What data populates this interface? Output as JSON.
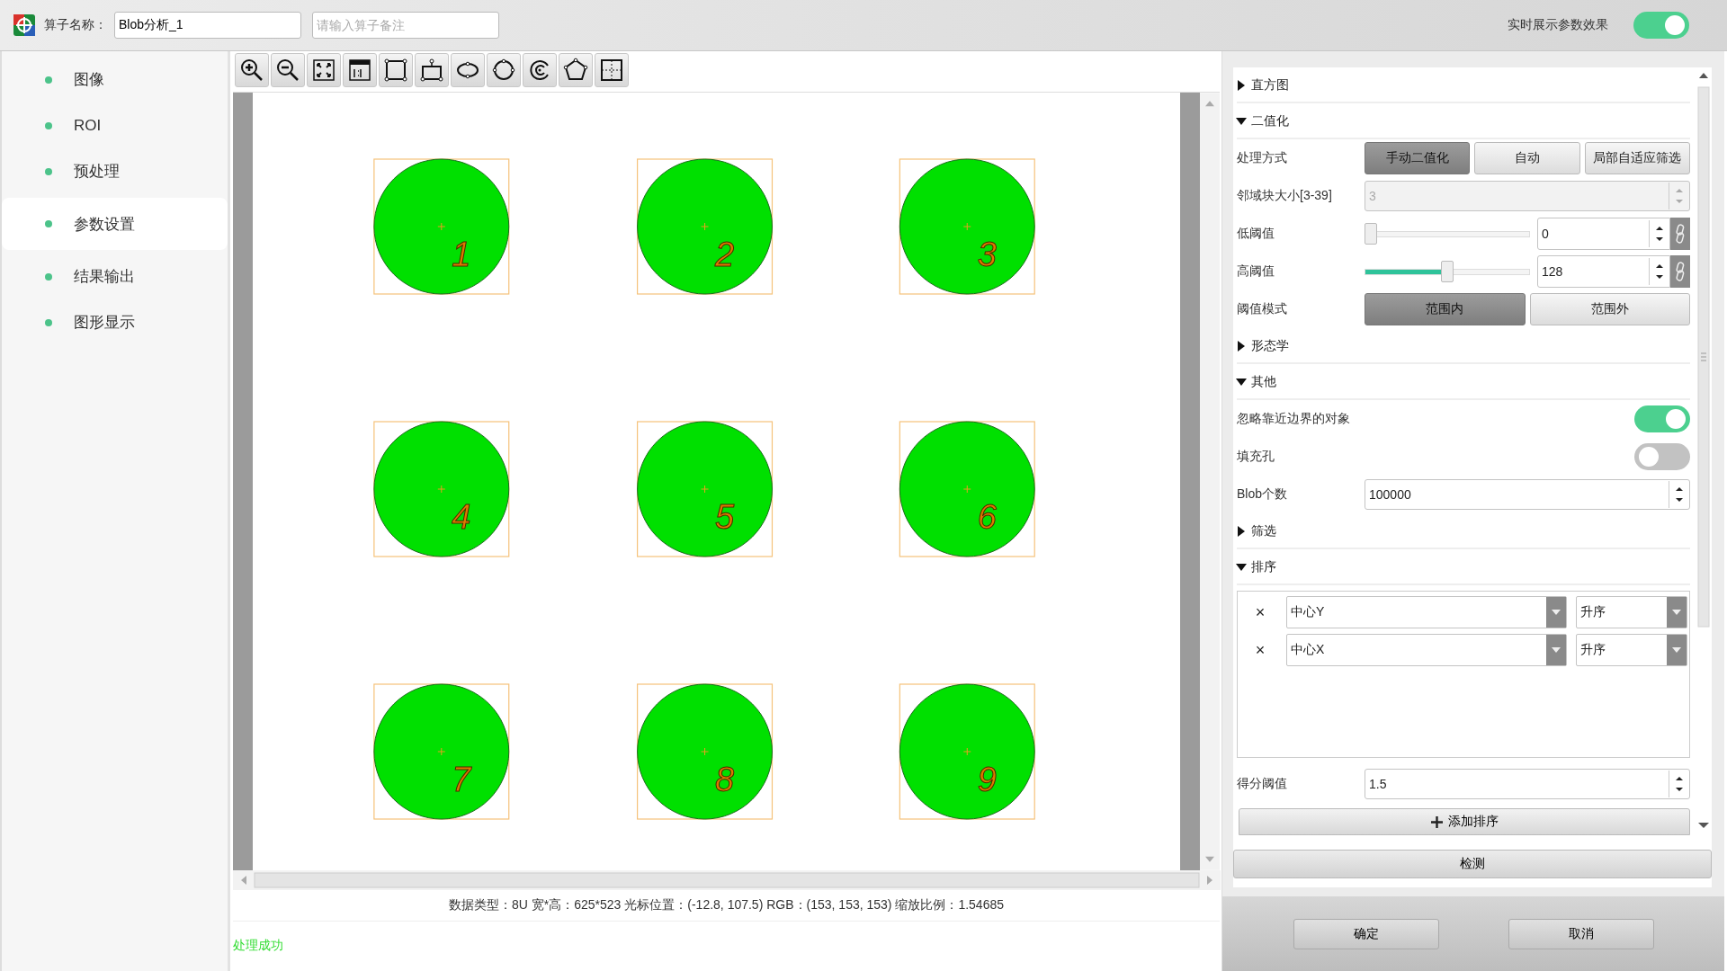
{
  "header": {
    "label": "算子名称：",
    "name_value": "Blob分析_1",
    "remark_placeholder": "请输入算子备注",
    "live_label": "实时展示参数效果",
    "live_on": true
  },
  "sidebar": {
    "items": [
      {
        "label": "图像",
        "selected": false
      },
      {
        "label": "ROI",
        "selected": false
      },
      {
        "label": "预处理",
        "selected": false
      },
      {
        "label": "参数设置",
        "selected": true
      },
      {
        "label": "结果输出",
        "selected": false
      },
      {
        "label": "图形显示",
        "selected": false
      }
    ]
  },
  "canvas": {
    "blobs": [
      {
        "label": "1"
      },
      {
        "label": "2"
      },
      {
        "label": "3"
      },
      {
        "label": "4"
      },
      {
        "label": "5"
      },
      {
        "label": "6"
      },
      {
        "label": "7"
      },
      {
        "label": "8"
      },
      {
        "label": "9"
      }
    ]
  },
  "status_line": "数据类型：8U 宽*高：625*523 光标位置：(-12.8, 107.5) RGB：(153, 153, 153) 缩放比例：1.54685",
  "message": "处理成功",
  "panel": {
    "sections": [
      {
        "title": "直方图",
        "expanded": false
      },
      {
        "title": "二值化",
        "expanded": true,
        "rows": [
          {
            "kind": "segmented",
            "label": "处理方式",
            "options": [
              {
                "label": "手动二值化",
                "selected": true
              },
              {
                "label": "自动",
                "selected": false
              },
              {
                "label": "局部自适应筛选",
                "selected": false
              }
            ]
          },
          {
            "kind": "spin",
            "label": "邻域块大小[3-39]",
            "value": "3",
            "disabled": true
          },
          {
            "kind": "slider",
            "label": "低阈值",
            "level": 0,
            "value": "0"
          },
          {
            "kind": "slider",
            "label": "高阈值",
            "level": 0.5,
            "value": "128"
          },
          {
            "kind": "segmented",
            "label": "阈值模式",
            "options": [
              {
                "label": "范围内",
                "selected": true
              },
              {
                "label": "范围外",
                "selected": false
              }
            ]
          }
        ]
      },
      {
        "title": "形态学",
        "expanded": false
      },
      {
        "title": "其他",
        "expanded": true,
        "rows": [
          {
            "kind": "toggle",
            "label": "忽略靠近边界的对象",
            "on": true
          },
          {
            "kind": "toggle",
            "label": "填充孔",
            "on": false
          },
          {
            "kind": "spin",
            "label": "Blob个数",
            "value": "100000",
            "disabled": false
          }
        ]
      },
      {
        "title": "筛选",
        "expanded": false
      },
      {
        "title": "排序",
        "expanded": true,
        "rows": [
          {
            "kind": "sort_list",
            "items": [
              {
                "remove": "×",
                "field": "中心Y",
                "order": "升序"
              },
              {
                "remove": "×",
                "field": "中心X",
                "order": "升序"
              }
            ]
          },
          {
            "kind": "spin",
            "label": "得分阈值",
            "value": "1.5",
            "disabled": false
          },
          {
            "kind": "add_button",
            "label": "添加排序"
          }
        ]
      }
    ]
  },
  "detect_button": "检测",
  "footer_buttons": [
    "确定",
    "取消"
  ]
}
